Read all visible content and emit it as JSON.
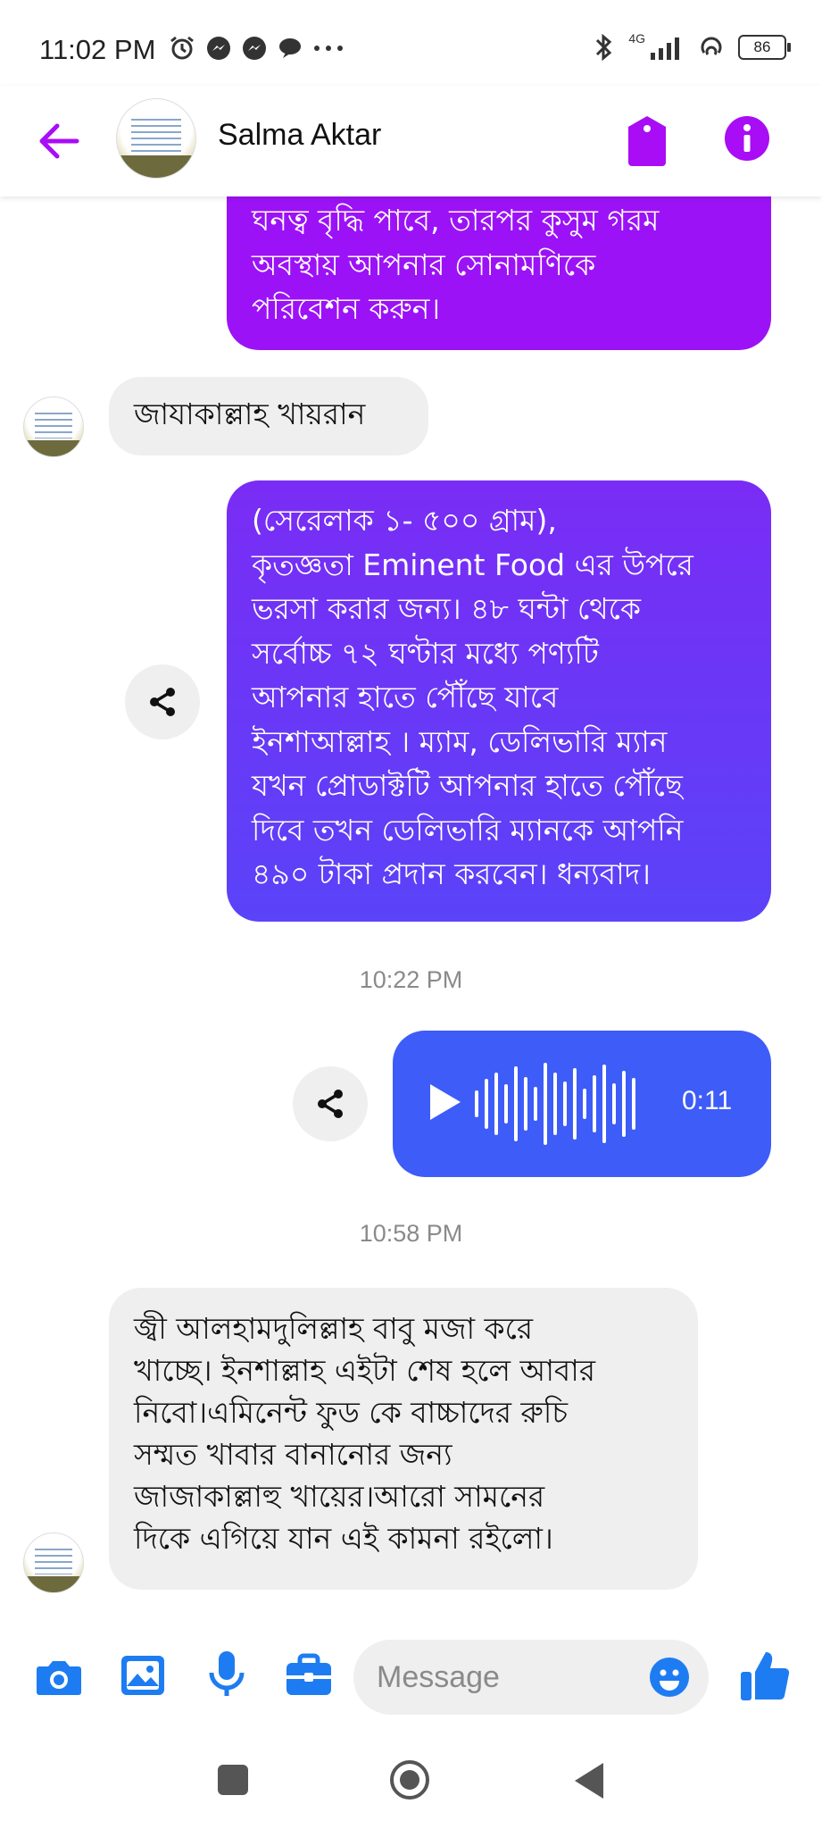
{
  "status_bar": {
    "time": "11:02 PM",
    "network": "4G",
    "battery": "86"
  },
  "header": {
    "contact_name": "Salma Aktar"
  },
  "messages": {
    "outgoing_1": [
      "ঘনত্ব বৃদ্ধি পাবে, তারপর কুসুম গরম",
      "অবস্থায় আপনার সোনামণিকে",
      "পরিবেশন করুন।"
    ],
    "incoming_1": "জাযাকাল্লাহ খায়রান",
    "outgoing_2": [
      "(সেরেলাক ১- ৫০০ গ্রাম),",
      "কৃতজ্ঞতা Eminent Food এর উপরে",
      "ভরসা করার জন্য।  ৪৮ ঘন্টা থেকে",
      "সর্বোচ্চ ৭২ ঘণ্টার মধ্যে পণ্যটি",
      "আপনার হাতে পৌঁছে যাবে",
      "ইনশাআল্লাহ । ম্যাম, ডেলিভারি ম্যান",
      "যখন প্রোডাক্টটি আপনার হাতে পৌঁছে",
      "দিবে তখন ডেলিভারি ম্যানকে আপনি",
      "৪৯০ টাকা প্রদান করবেন। ধন্যবাদ।"
    ],
    "timestamp_1": "10:22 PM",
    "voice_duration": "0:11",
    "timestamp_2": "10:58 PM",
    "incoming_2": [
      "জ্বী আলহামদুলিল্লাহ  বাবু মজা করে",
      "খাচ্ছে। ইনশাল্লাহ এইটা শেষ হলে আবার",
      "নিবো।এমিনেন্ট ফুড কে বাচ্চাদের রুচি",
      "সম্মত খাবার বানানোর জন্য",
      "জাজাকাল্লাহু খায়ের।আরো সামনের",
      "দিকে এগিয়ে যান এই কামনা রইলো।"
    ]
  },
  "composer": {
    "placeholder": "Message"
  },
  "colors": {
    "accent": "#a80df5",
    "outgoing_bubble_top": "#9c12f6",
    "voice_bubble": "#3e5cf8",
    "messenger_blue": "#1e7cf2"
  },
  "icons": [
    "back-arrow-icon",
    "tag-icon",
    "info-icon",
    "share-icon",
    "play-icon",
    "camera-icon",
    "gallery-icon",
    "microphone-icon",
    "briefcase-icon",
    "emoji-icon",
    "like-icon"
  ]
}
